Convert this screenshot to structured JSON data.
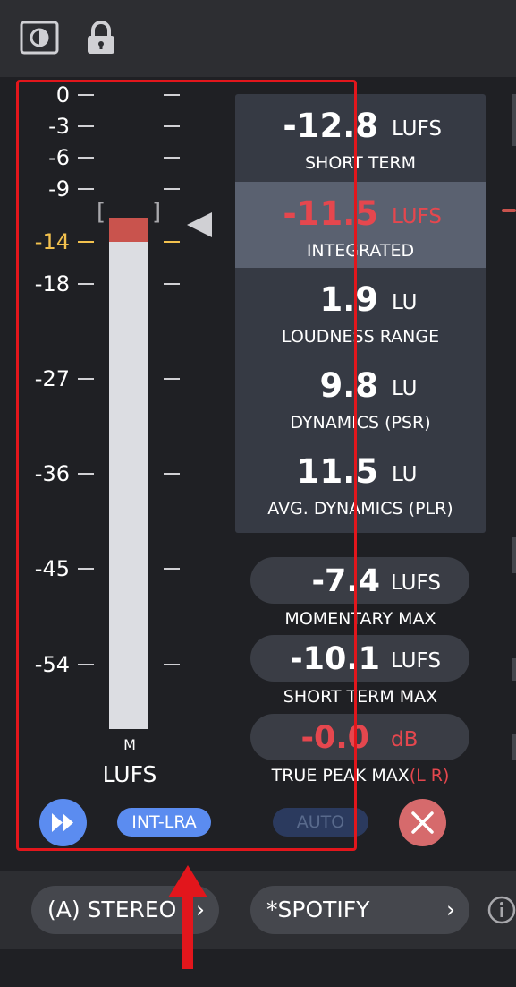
{
  "toolbar": {
    "display_icon": "display-mode-icon",
    "lock_icon": "lock-icon"
  },
  "meter": {
    "scale": [
      "0",
      "-3",
      "-6",
      "-9",
      "-14",
      "-18",
      "-27",
      "-36",
      "-45",
      "-54"
    ],
    "target_label": "-14",
    "target_color": "#f2c14e",
    "level_fraction": 1.0,
    "channel_label": "M",
    "unit_label": "LUFS",
    "left_bracket": "[",
    "right_bracket": "]"
  },
  "stats": [
    {
      "value": "-12.8",
      "unit": "LUFS",
      "caption": "SHORT TERM"
    },
    {
      "value": "-11.5",
      "unit": "LUFS",
      "caption": "INTEGRATED"
    },
    {
      "value": "1.9",
      "unit": "LU",
      "caption": "LOUDNESS RANGE"
    },
    {
      "value": "9.8",
      "unit": "LU",
      "caption": "DYNAMICS (PSR)"
    },
    {
      "value": "11.5",
      "unit": "LU",
      "caption": "AVG. DYNAMICS (PLR)"
    }
  ],
  "maxes": [
    {
      "value": "-7.4",
      "unit": "LUFS",
      "caption": "MOMENTARY MAX"
    },
    {
      "value": "-10.1",
      "unit": "LUFS",
      "caption": "SHORT TERM MAX"
    },
    {
      "value": "-0.0",
      "unit": "dB",
      "caption": "TRUE PEAK MAX",
      "caption_suffix": "(L R)"
    }
  ],
  "controls": {
    "play_icon": "fast-forward-icon",
    "int_lra_label": "INT-LRA",
    "auto_label": "AUTO",
    "reset_icon": "close-icon"
  },
  "bottom": {
    "channel_mode": "(A) STEREO",
    "preset": "*SPOTIFY",
    "chevron": "›",
    "info_icon": "info-icon"
  },
  "colors": {
    "accent_blue": "#5b8cf0",
    "alert_red": "#e5474e",
    "panel": "#363a44",
    "highlight": "#5a6170",
    "annotation": "#e2161c"
  }
}
